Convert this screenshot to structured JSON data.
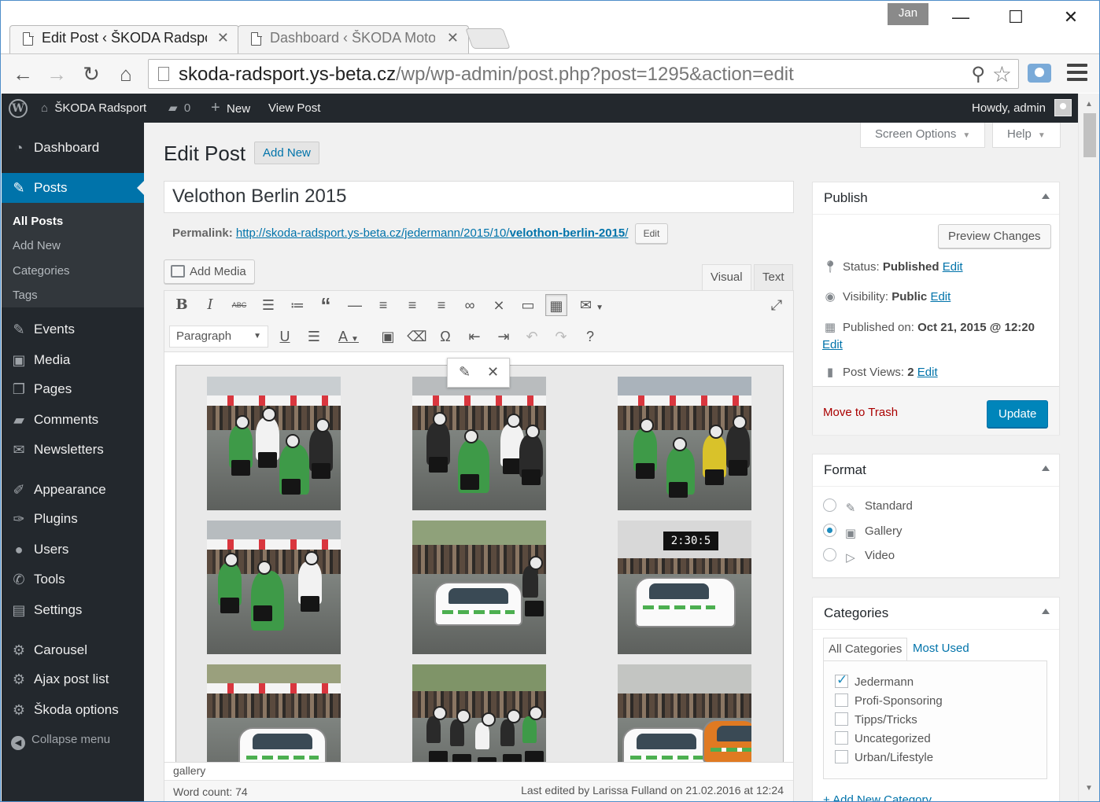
{
  "browser": {
    "user": "Jan",
    "tabs": [
      {
        "title": "Edit Post ‹ ŠKODA Radspo",
        "active": true
      },
      {
        "title": "Dashboard ‹ ŠKODA Moto",
        "active": false
      }
    ],
    "url_host": "skoda-radsport.ys-beta.cz",
    "url_path": "/wp/wp-admin/post.php?post=1295&action=edit"
  },
  "adminbar": {
    "site_name": "ŠKODA Radsport",
    "comments_count": "0",
    "new_label": "New",
    "view_post_label": "View Post",
    "howdy": "Howdy, admin"
  },
  "sidebar": {
    "items": [
      {
        "label": "Dashboard",
        "icon": "dashboard-icon"
      },
      {
        "label": "Posts",
        "icon": "pin-icon",
        "current": true
      },
      {
        "label": "Events",
        "icon": "pin-icon"
      },
      {
        "label": "Media",
        "icon": "media-icon"
      },
      {
        "label": "Pages",
        "icon": "pages-icon"
      },
      {
        "label": "Comments",
        "icon": "comment-icon"
      },
      {
        "label": "Newsletters",
        "icon": "mail-icon"
      },
      {
        "label": "Appearance",
        "icon": "brush-icon"
      },
      {
        "label": "Plugins",
        "icon": "plugin-icon"
      },
      {
        "label": "Users",
        "icon": "users-icon"
      },
      {
        "label": "Tools",
        "icon": "wrench-icon"
      },
      {
        "label": "Settings",
        "icon": "settings-icon"
      },
      {
        "label": "Carousel",
        "icon": "gear-icon"
      },
      {
        "label": "Ajax post list",
        "icon": "gear-icon"
      },
      {
        "label": "Škoda options",
        "icon": "gear-icon"
      }
    ],
    "submenu": [
      "All Posts",
      "Add New",
      "Categories",
      "Tags"
    ],
    "collapse_label": "Collapse menu"
  },
  "screen": {
    "screen_options": "Screen Options",
    "help": "Help"
  },
  "editor": {
    "page_title": "Edit Post",
    "add_new": "Add New",
    "post_title": "Velothon Berlin 2015",
    "permalink_label": "Permalink:",
    "permalink_base": "http://skoda-radsport.ys-beta.cz/jedermann/2015/10/",
    "permalink_slug": "velothon-berlin-2015",
    "permalink_end": "/",
    "edit_label": "Edit",
    "add_media": "Add Media",
    "tab_visual": "Visual",
    "tab_text": "Text",
    "format_value": "Paragraph",
    "path": "gallery",
    "word_count": "Word count: 74",
    "last_edited": "Last edited by Larissa Fulland on 21.02.2016 at 12:24",
    "finish_clock": "2:30:5"
  },
  "publish": {
    "title": "Publish",
    "preview": "Preview Changes",
    "status_label": "Status:",
    "status_value": "Published",
    "visibility_label": "Visibility:",
    "visibility_value": "Public",
    "published_label": "Published on:",
    "published_value": "Oct 21, 2015 @ 12:20",
    "views_label": "Post Views:",
    "views_value": "2",
    "edit": "Edit",
    "trash": "Move to Trash",
    "update": "Update"
  },
  "format": {
    "title": "Format",
    "options": [
      {
        "label": "Standard",
        "checked": false
      },
      {
        "label": "Gallery",
        "checked": true
      },
      {
        "label": "Video",
        "checked": false
      }
    ]
  },
  "categories": {
    "title": "Categories",
    "tab_all": "All Categories",
    "tab_most": "Most Used",
    "items": [
      {
        "label": "Jedermann",
        "checked": true
      },
      {
        "label": "Profi-Sponsoring",
        "checked": false
      },
      {
        "label": "Tipps/Tricks",
        "checked": false
      },
      {
        "label": "Uncategorized",
        "checked": false
      },
      {
        "label": "Urban/Lifestyle",
        "checked": false
      }
    ],
    "add_new": "+ Add New Category"
  },
  "colors": {
    "admin_dark": "#23282d",
    "accent": "#0073aa",
    "primary_button": "#0085ba",
    "trash": "#aa0000"
  }
}
